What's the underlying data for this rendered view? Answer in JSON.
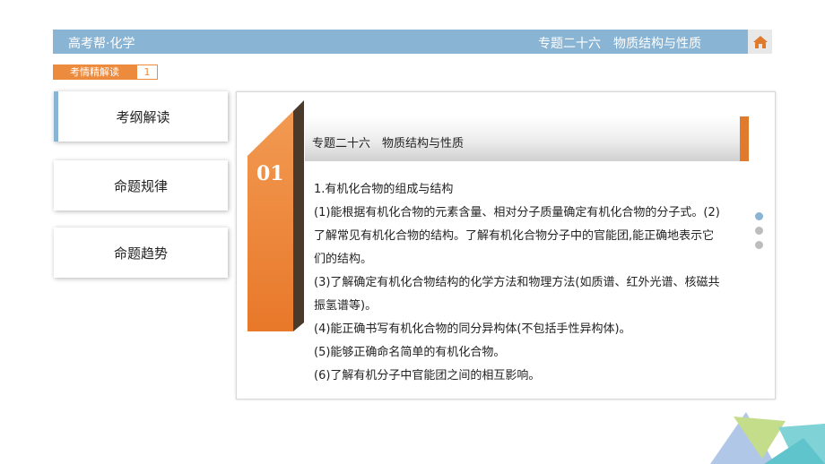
{
  "header": {
    "brand": "高考帮·化学",
    "topic": "专题二十六　物质结构与性质"
  },
  "section": {
    "tag": "考情精解读",
    "page": "1"
  },
  "nav": {
    "items": [
      {
        "label": "考纲解读"
      },
      {
        "label": "命题规律"
      },
      {
        "label": "命题趋势"
      }
    ]
  },
  "panel": {
    "number": "01",
    "title": "专题二十六　物质结构与性质",
    "lines": [
      "1.有机化合物的组成与结构",
      "(1)能根据有机化合物的元素含量、相对分子质量确定有机化合物的分子式。(2)了解常见有机化合物的结构。了解有机化合物分子中的官能团,能正确地表示它们的结构。",
      "(3)了解确定有机化合物结构的化学方法和物理方法(如质谱、红外光谱、核磁共振氢谱等)。",
      "(4)能正确书写有机化合物的同分异构体(不包括手性异构体)。",
      "(5)能够正确命名简单的有机化合物。",
      "(6)了解有机分子中官能团之间的相互影响。"
    ]
  },
  "colors": {
    "accent_blue": "#8ab4d3",
    "accent_orange": "#ec8a3e",
    "home_icon": "#e07a2c"
  }
}
